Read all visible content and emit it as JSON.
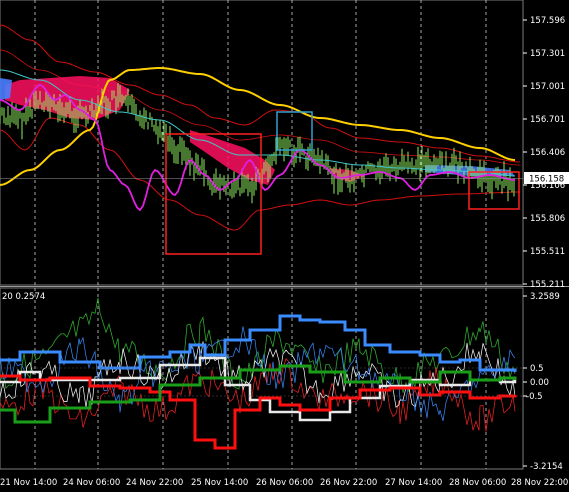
{
  "indicator_label": "20 0.2574",
  "price_axis": {
    "ticks": [
      "157.596",
      "157.301",
      "157.001",
      "156.701",
      "156.406",
      "156.106",
      "155.806",
      "155.511",
      "155.211"
    ],
    "current_price": "156.158"
  },
  "osc_axis": {
    "ticks": [
      "3.2589",
      "0.5",
      "0.00",
      "-0.5",
      "-3.2154"
    ]
  },
  "time_axis": {
    "labels": [
      "21 Nov 14:00",
      "24 Nov 06:00",
      "24 Nov 22:00",
      "25 Nov 14:00",
      "26 Nov 06:00",
      "26 Nov 22:00",
      "27 Nov 14:00",
      "28 Nov 06:00",
      "28 Nov 22:00"
    ]
  },
  "colors": {
    "background": "#000000",
    "price_bars": "#90ee60",
    "ma_yellow": "#ffd000",
    "envelope": "#d01010",
    "cloud_fill": "#ff1060",
    "magenta": "#e020e0",
    "box_red": "#ff2020",
    "box_cyan": "#30a0d0",
    "osc_blue": "#3a8cff",
    "osc_white": "#e8e8e8",
    "osc_red": "#ff1010",
    "osc_green": "#1a9e1a"
  }
}
